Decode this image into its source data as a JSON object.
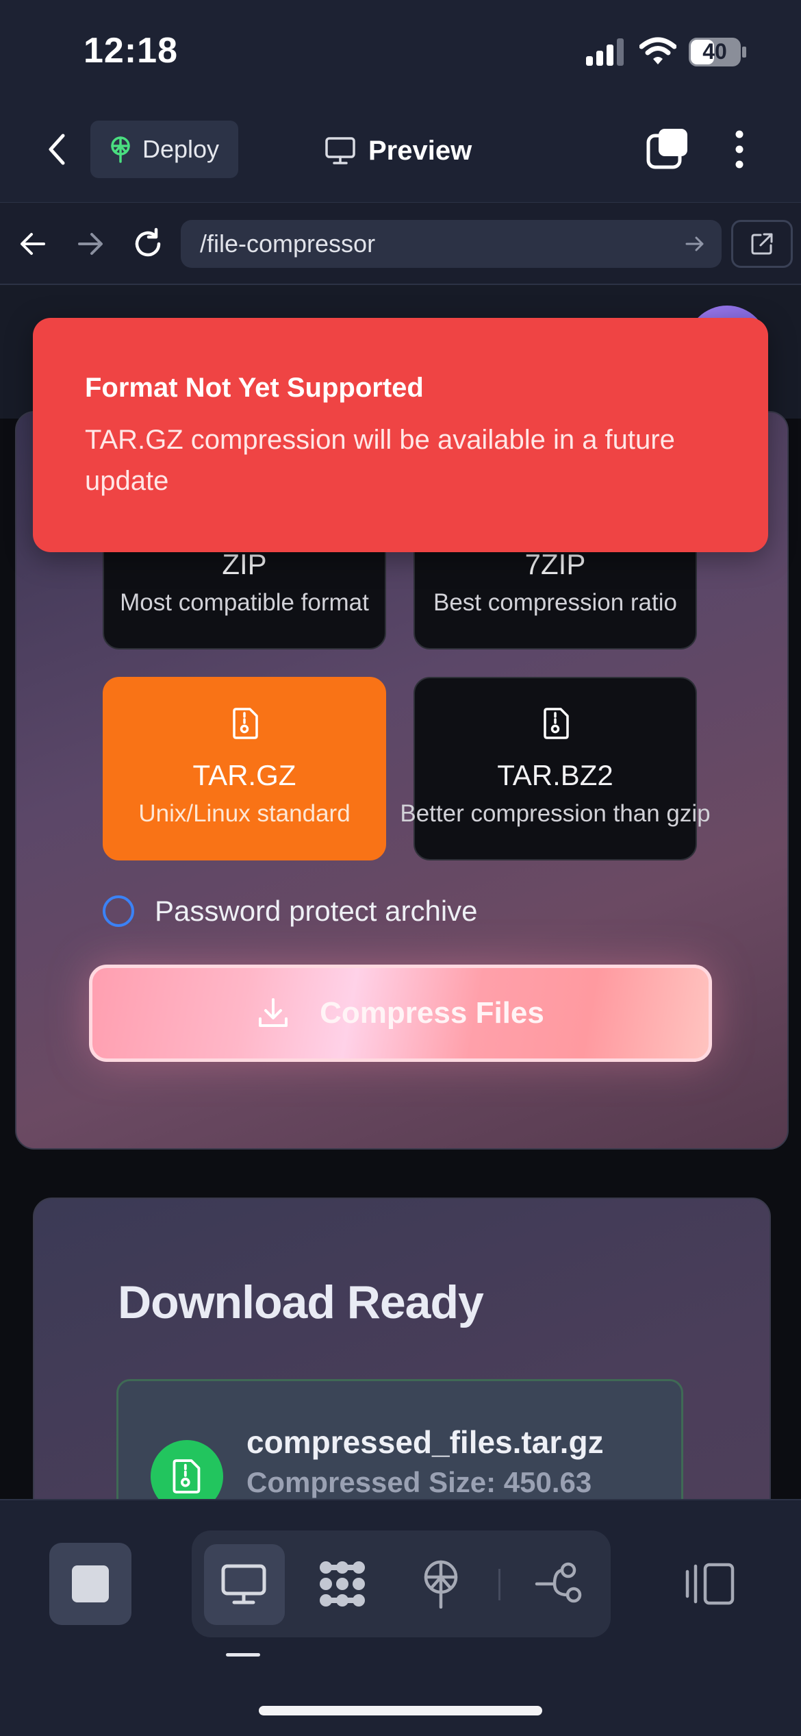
{
  "status_bar": {
    "time": "12:18",
    "battery": "40"
  },
  "nav": {
    "deploy_label": "Deploy",
    "preview_label": "Preview"
  },
  "browser": {
    "url": "/file-compressor"
  },
  "formats": [
    {
      "name": "ZIP",
      "desc": "Most compatible format",
      "selected": false
    },
    {
      "name": "7ZIP",
      "desc": "Best compression ratio",
      "selected": false
    },
    {
      "name": "TAR.GZ",
      "desc": "Unix/Linux standard",
      "selected": true
    },
    {
      "name": "TAR.BZ2",
      "desc": "Better compression than gzip",
      "selected": false
    }
  ],
  "options": {
    "password_label": "Password protect archive",
    "password_checked": false
  },
  "actions": {
    "compress_label": "Compress Files"
  },
  "download": {
    "title": "Download Ready",
    "file_name": "compressed_files.tar.gz",
    "size_text": "Compressed Size: 450.63"
  },
  "toast": {
    "title": "Format Not Yet Supported",
    "message": "TAR.GZ compression will be available in a future update"
  },
  "colors": {
    "accent": "#f97316",
    "toast": "#ef4444",
    "success": "#22c55e",
    "radio": "#3b82f6"
  },
  "icons": [
    "back-chevron-icon",
    "deploy-icon",
    "monitor-icon",
    "tabs-icon",
    "more-vertical-icon",
    "back-arrow-icon",
    "forward-arrow-icon",
    "reload-icon",
    "go-arrow-icon",
    "external-link-icon",
    "file-archive-icon",
    "download-icon",
    "stop-icon",
    "grid-icon",
    "antenna-icon",
    "workflow-icon",
    "panel-icon"
  ]
}
